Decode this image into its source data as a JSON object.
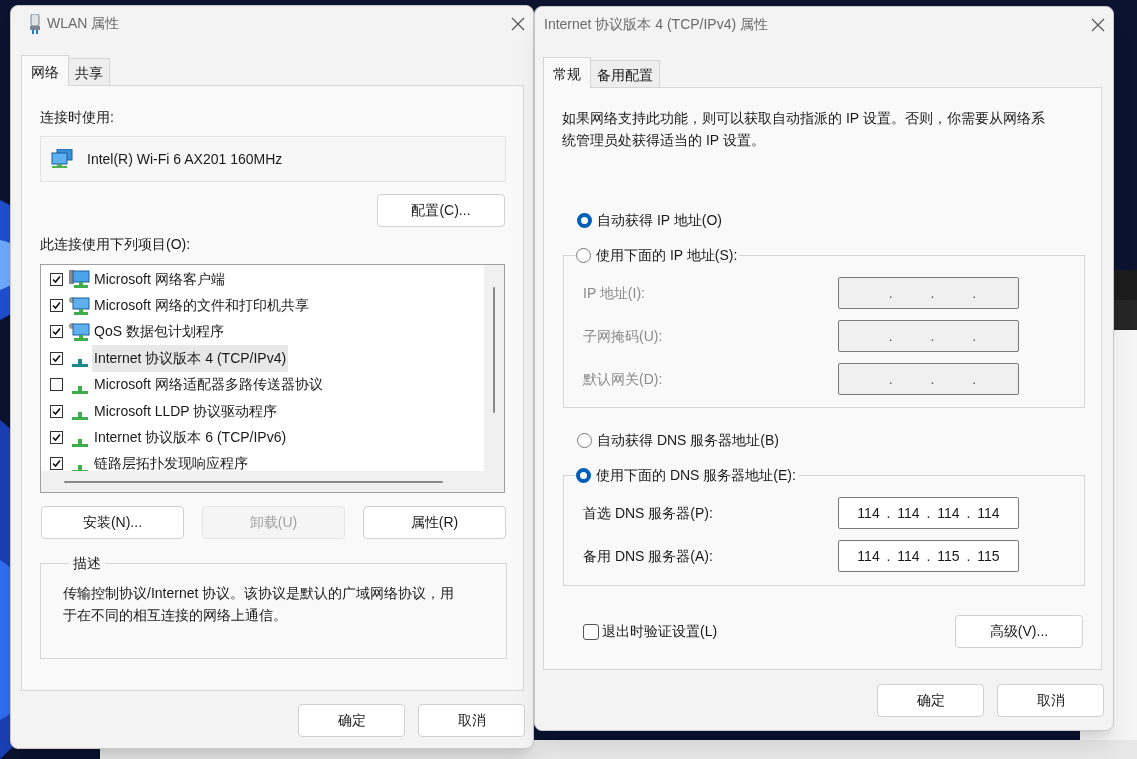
{
  "wlan_dialog": {
    "title": "WLAN 属性",
    "tabs": [
      {
        "label": "网络",
        "selected": true
      },
      {
        "label": "共享",
        "selected": false
      }
    ],
    "connect_using_label": "连接时使用:",
    "adapter": "Intel(R) Wi-Fi 6 AX201 160MHz",
    "configure_button": "配置(C)...",
    "items_label": "此连接使用下列项目(O):",
    "items": [
      {
        "label": "Microsoft 网络客户端",
        "checked": true,
        "kind": "client",
        "selected": false
      },
      {
        "label": "Microsoft 网络的文件和打印机共享",
        "checked": true,
        "kind": "service",
        "selected": false
      },
      {
        "label": "QoS 数据包计划程序",
        "checked": true,
        "kind": "service",
        "selected": false
      },
      {
        "label": "Internet 协议版本 4 (TCP/IPv4)",
        "checked": true,
        "kind": "protocol",
        "selected": true
      },
      {
        "label": "Microsoft 网络适配器多路传送器协议",
        "checked": false,
        "kind": "protocol",
        "selected": false
      },
      {
        "label": "Microsoft LLDP 协议驱动程序",
        "checked": true,
        "kind": "protocol",
        "selected": false
      },
      {
        "label": "Internet 协议版本 6 (TCP/IPv6)",
        "checked": true,
        "kind": "protocol",
        "selected": false
      },
      {
        "label": "链路层拓扑发现响应程序",
        "checked": true,
        "kind": "protocol",
        "selected": false
      }
    ],
    "item_buttons": [
      {
        "label": "安装(N)...",
        "disabled": false
      },
      {
        "label": "卸载(U)",
        "disabled": true
      },
      {
        "label": "属性(R)",
        "disabled": false
      }
    ],
    "description": {
      "legend": "描述",
      "text": "传输控制协议/Internet 协议。该协议是默认的广域网络协议，用于在不同的相互连接的网络上通信。"
    },
    "buttons": [
      "确定",
      "取消"
    ]
  },
  "ipv4_dialog": {
    "title": "Internet 协议版本 4 (TCP/IPv4) 属性",
    "tabs": [
      {
        "label": "常规",
        "selected": true
      },
      {
        "label": "备用配置",
        "selected": false
      }
    ],
    "intro": "如果网络支持此功能，则可以获取自动指派的 IP 设置。否则，你需要从网络系统管理员处获得适当的 IP 设置。",
    "ip_mode": [
      {
        "label": "自动获得 IP 地址(O)",
        "selected": true
      },
      {
        "label": "使用下面的 IP 地址(S):",
        "selected": false
      }
    ],
    "ip_fields": [
      {
        "label": "IP 地址(I):",
        "value": ". . ."
      },
      {
        "label": "子网掩码(U):",
        "value": ". . ."
      },
      {
        "label": "默认网关(D):",
        "value": ". . ."
      }
    ],
    "dns_mode": [
      {
        "label": "自动获得 DNS 服务器地址(B)",
        "selected": false
      },
      {
        "label": "使用下面的 DNS 服务器地址(E):",
        "selected": true
      }
    ],
    "dns_fields": [
      {
        "label": "首选 DNS 服务器(P):",
        "value": "114 . 114 . 114 . 114"
      },
      {
        "label": "备用 DNS 服务器(A):",
        "value": "114 . 114 . 115 . 115"
      }
    ],
    "validate_on_exit": {
      "label": "退出时验证设置(L)",
      "checked": false
    },
    "advanced_button": "高级(V)...",
    "buttons": [
      "确定",
      "取消"
    ]
  }
}
